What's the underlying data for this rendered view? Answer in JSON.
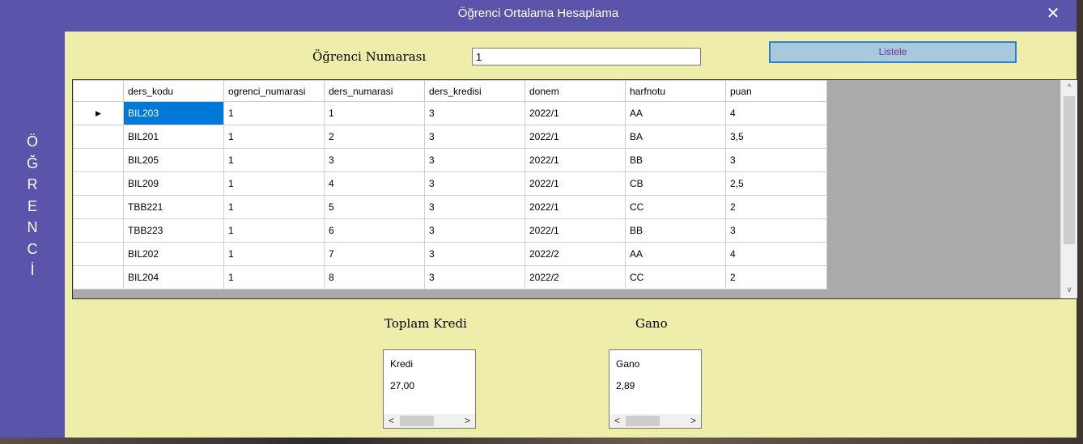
{
  "window": {
    "title": "Öğrenci Ortalama Hesaplama",
    "close_glyph": "✕"
  },
  "sidebar": {
    "letters": [
      "Ö",
      "Ğ",
      "R",
      "E",
      "N",
      "C",
      "İ"
    ]
  },
  "form": {
    "student_number_label": "Öğrenci Numarası",
    "student_number_value": "1",
    "list_button": "Listele"
  },
  "grid": {
    "columns": [
      "ders_kodu",
      "ogrenci_numarasi",
      "ders_numarasi",
      "ders_kredisi",
      "donem",
      "harfnotu",
      "puan"
    ],
    "current_row_marker": "▶",
    "rows": [
      [
        "BIL203",
        "1",
        "1",
        "3",
        "2022/1",
        "AA",
        "4"
      ],
      [
        "BIL201",
        "1",
        "2",
        "3",
        "2022/1",
        "BA",
        "3,5"
      ],
      [
        "BIL205",
        "1",
        "3",
        "3",
        "2022/1",
        "BB",
        "3"
      ],
      [
        "BIL209",
        "1",
        "4",
        "3",
        "2022/1",
        "CB",
        "2,5"
      ],
      [
        "TBB221",
        "1",
        "5",
        "3",
        "2022/1",
        "CC",
        "2"
      ],
      [
        "TBB223",
        "1",
        "6",
        "3",
        "2022/1",
        "BB",
        "3"
      ],
      [
        "BIL202",
        "1",
        "7",
        "3",
        "2022/2",
        "AA",
        "4"
      ],
      [
        "BIL204",
        "1",
        "8",
        "3",
        "2022/2",
        "CC",
        "2"
      ]
    ],
    "scroll_up_glyph": "^",
    "scroll_down_glyph": "v"
  },
  "summary": {
    "total_credit_label": "Toplam Kredi",
    "gano_label": "Gano",
    "credit_grid": {
      "header": "Kredi",
      "value": "27,00"
    },
    "gano_grid": {
      "header": "Gano",
      "value": "2,89"
    },
    "scroll_left_glyph": "<",
    "scroll_right_glyph": ">"
  },
  "colors": {
    "window_frame": "#5a55aa",
    "form_background": "#efedaa",
    "selection": "#0078d7",
    "button_background": "#a8c8dc",
    "button_text": "#7b2ca0"
  }
}
